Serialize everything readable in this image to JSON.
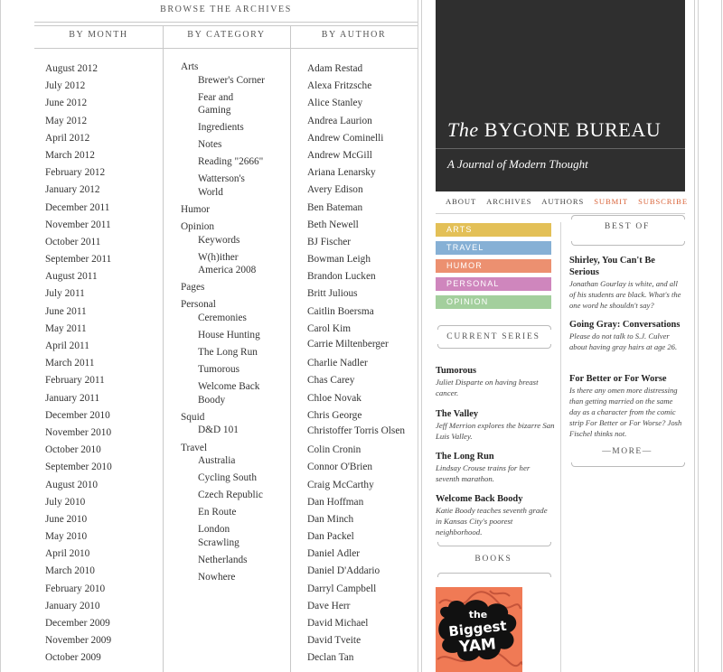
{
  "archives": {
    "title": "BROWSE THE ARCHIVES",
    "headers": {
      "month": "BY MONTH",
      "category": "BY CATEGORY",
      "author": "BY AUTHOR"
    },
    "months": [
      "August 2012",
      "July 2012",
      "June 2012",
      "May 2012",
      "April 2012",
      "March 2012",
      "February 2012",
      "January 2012",
      "December 2011",
      "November 2011",
      "October 2011",
      "September 2011",
      "August 2011",
      "July 2011",
      "June 2011",
      "May 2011",
      "April 2011",
      "March 2011",
      "February 2011",
      "January 2011",
      "December 2010",
      "November 2010",
      "October 2010",
      "September 2010",
      "August 2010",
      "July 2010",
      "June 2010",
      "May 2010",
      "April 2010",
      "March 2010",
      "February 2010",
      "January 2010",
      "December 2009",
      "November 2009",
      "October 2009"
    ],
    "categories": [
      {
        "name": "Arts",
        "children": [
          "Brewer's Corner",
          "Fear and Gaming",
          "Ingredients",
          "Notes",
          "Reading \"2666\"",
          "Watterson's World"
        ]
      },
      {
        "name": "Humor",
        "children": []
      },
      {
        "name": "Opinion",
        "children": [
          "Keywords",
          "W(h)ither America 2008"
        ]
      },
      {
        "name": "Pages",
        "children": []
      },
      {
        "name": "Personal",
        "children": [
          "Ceremonies",
          "House Hunting",
          "The Long Run",
          "Tumorous",
          "Welcome Back Boody"
        ]
      },
      {
        "name": "Squid",
        "children": [
          "D&D 101"
        ]
      },
      {
        "name": "Travel",
        "children": [
          "Australia",
          "Cycling South",
          "Czech Republic",
          "En Route",
          "London Scrawling",
          "Netherlands",
          "Nowhere"
        ]
      }
    ],
    "authors": [
      "Adam Restad",
      "Alexa Fritzsche",
      "Alice Stanley",
      "Andrea Laurion",
      "Andrew Cominelli",
      "Andrew McGill",
      "Ariana Lenarsky",
      "Avery Edison",
      "Ben Bateman",
      "Beth Newell",
      "BJ Fischer",
      "Bowman Leigh",
      "Brandon Lucken",
      "Britt Julious",
      "Caitlin Boersma",
      "Carol Kim",
      "Carrie Miltenberger",
      "Charlie Nadler",
      "Chas Carey",
      "Chloe Novak",
      "Chris George",
      "Christoffer Torris Olsen",
      "Colin Cronin",
      "Connor O'Brien",
      "Craig McCarthy",
      "Dan Hoffman",
      "Dan Minch",
      "Dan Packel",
      "Daniel Adler",
      "Daniel D'Addario",
      "Darryl Campbell",
      "Dave Herr",
      "David Michael",
      "David Tveite",
      "Declan Tan"
    ]
  },
  "masthead": {
    "the": "The",
    "title": "BYGONE BUREAU",
    "subtitle": "A Journal of Modern Thought"
  },
  "nav": [
    {
      "label": "ABOUT",
      "highlight": false
    },
    {
      "label": "ARCHIVES",
      "highlight": false
    },
    {
      "label": "AUTHORS",
      "highlight": false
    },
    {
      "label": "SUBMIT",
      "highlight": true
    },
    {
      "label": "SUBSCRIBE",
      "highlight": true
    }
  ],
  "sections": [
    {
      "label": "ARTS",
      "color": "#e3c057"
    },
    {
      "label": "TRAVEL",
      "color": "#86b0d5"
    },
    {
      "label": "HUMOR",
      "color": "#ec9070"
    },
    {
      "label": "PERSONAL",
      "color": "#cf86bd"
    },
    {
      "label": "OPINION",
      "color": "#a3cf9d"
    }
  ],
  "current_series": {
    "heading": "CURRENT SERIES",
    "items": [
      {
        "title": "Tumorous",
        "desc": "Juliet Disparte on having breast cancer."
      },
      {
        "title": "The Valley",
        "desc": "Jeff Merrion explores the bizarre San Luis Valley."
      },
      {
        "title": "The Long Run",
        "desc": "Lindsay Crouse trains for her seventh marathon."
      },
      {
        "title": "Welcome Back Boody",
        "desc": "Katie Boody teaches seventh grade in Kansas City's poorest neighborhood."
      }
    ]
  },
  "best_of": {
    "heading": "BEST OF",
    "items": [
      {
        "title": "Shirley, You Can't Be Serious",
        "desc": "Jonathan Gourlay is white, and all of his students are black. What's the one word he shouldn't say?"
      },
      {
        "title": "Going Gray: Conversations",
        "desc": "Please do not talk to S.J. Culver about having gray hairs at age 26."
      },
      {
        "title": "For Better or For Worse",
        "desc": "Is there any omen more distressing than getting married on the same day as a character from the comic strip For Better or For Worse? Josh Fischel thinks not."
      }
    ],
    "more": "—MORE—"
  },
  "books": {
    "heading": "BOOKS",
    "cover_text": [
      "the",
      "Biggest",
      "YAM"
    ]
  }
}
